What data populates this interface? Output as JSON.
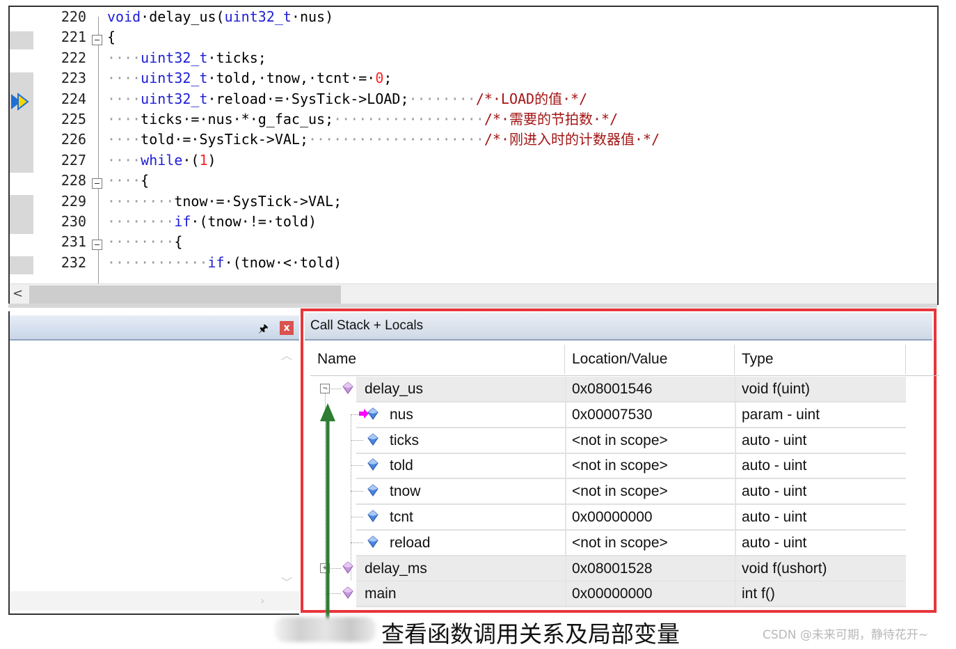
{
  "editor": {
    "lines": [
      {
        "num": "220",
        "code": [
          {
            "t": "void",
            "c": "kw"
          },
          {
            "t": "·delay_us(",
            "c": ""
          },
          {
            "t": "uint32_t",
            "c": "kw"
          },
          {
            "t": "·nus)",
            "c": ""
          }
        ]
      },
      {
        "num": "221",
        "code": [
          {
            "t": "{",
            "c": ""
          }
        ]
      },
      {
        "num": "222",
        "code": [
          {
            "t": "····",
            "c": "dot"
          },
          {
            "t": "uint32_t",
            "c": "kw"
          },
          {
            "t": "·ticks;",
            "c": ""
          }
        ]
      },
      {
        "num": "223",
        "code": [
          {
            "t": "····",
            "c": "dot"
          },
          {
            "t": "uint32_t",
            "c": "kw"
          },
          {
            "t": "·told,·tnow,·tcnt·=·",
            "c": ""
          },
          {
            "t": "0",
            "c": "num"
          },
          {
            "t": ";",
            "c": ""
          }
        ]
      },
      {
        "num": "224",
        "code": [
          {
            "t": "····",
            "c": "dot"
          },
          {
            "t": "uint32_t",
            "c": "kw"
          },
          {
            "t": "·reload·=·SysTick->LOAD;",
            "c": ""
          },
          {
            "t": "········",
            "c": "dot"
          },
          {
            "t": "/*·LOAD的值·*/",
            "c": "cmt"
          }
        ]
      },
      {
        "num": "225",
        "code": [
          {
            "t": "····",
            "c": "dot"
          },
          {
            "t": "ticks·=·nus·*·g_fac_us;",
            "c": ""
          },
          {
            "t": "··················",
            "c": "dot"
          },
          {
            "t": "/*·需要的节拍数·*/",
            "c": "cmt"
          }
        ]
      },
      {
        "num": "226",
        "code": [
          {
            "t": "····",
            "c": "dot"
          },
          {
            "t": "told·=·SysTick->VAL;",
            "c": ""
          },
          {
            "t": "·····················",
            "c": "dot"
          },
          {
            "t": "/*·刚进入时的计数器值·*/",
            "c": "cmt"
          }
        ]
      },
      {
        "num": "227",
        "code": [
          {
            "t": "····",
            "c": "dot"
          },
          {
            "t": "while",
            "c": "kw"
          },
          {
            "t": "·(",
            "c": ""
          },
          {
            "t": "1",
            "c": "num"
          },
          {
            "t": ")",
            "c": ""
          }
        ]
      },
      {
        "num": "228",
        "code": [
          {
            "t": "····",
            "c": "dot"
          },
          {
            "t": "{",
            "c": ""
          }
        ]
      },
      {
        "num": "229",
        "code": [
          {
            "t": "········",
            "c": "dot"
          },
          {
            "t": "tnow·=·SysTick->VAL;",
            "c": ""
          }
        ]
      },
      {
        "num": "230",
        "code": [
          {
            "t": "········",
            "c": "dot"
          },
          {
            "t": "if",
            "c": "kw"
          },
          {
            "t": "·(tnow·!=·told)",
            "c": ""
          }
        ]
      },
      {
        "num": "231",
        "code": [
          {
            "t": "········",
            "c": "dot"
          },
          {
            "t": "{",
            "c": ""
          }
        ]
      },
      {
        "num": "232",
        "code": [
          {
            "t": "············",
            "c": "dot"
          },
          {
            "t": "if",
            "c": "kw"
          },
          {
            "t": "·(tnow·<·told)",
            "c": ""
          }
        ]
      }
    ],
    "scroll_left_glyph": "<"
  },
  "left_panel": {
    "pin_glyph": "🖈",
    "close_glyph": "x"
  },
  "callstack": {
    "title": "Call Stack + Locals",
    "headers": {
      "name": "Name",
      "location": "Location/Value",
      "type": "Type"
    },
    "rows": [
      {
        "kind": "frame",
        "expand": "−",
        "name": "delay_us",
        "location": "0x08001546",
        "type": "void f(uint)"
      },
      {
        "kind": "param",
        "name": "nus",
        "location": "0x00007530",
        "type": "param - uint"
      },
      {
        "kind": "local",
        "name": "ticks",
        "location": "<not in scope>",
        "type": "auto - uint"
      },
      {
        "kind": "local",
        "name": "told",
        "location": "<not in scope>",
        "type": "auto - uint"
      },
      {
        "kind": "local",
        "name": "tnow",
        "location": "<not in scope>",
        "type": "auto - uint"
      },
      {
        "kind": "local",
        "name": "tcnt",
        "location": "0x00000000",
        "type": "auto - uint"
      },
      {
        "kind": "local",
        "name": "reload",
        "location": "<not in scope>",
        "type": "auto - uint"
      },
      {
        "kind": "frame",
        "expand": "+",
        "name": "delay_ms",
        "location": "0x08001528",
        "type": "void f(ushort)"
      },
      {
        "kind": "frame",
        "expand": "",
        "name": "main",
        "location": "0x00000000",
        "type": "int f()"
      }
    ]
  },
  "caption": "查看函数调用关系及局部变量",
  "watermark": "CSDN @未来可期，静待花开~",
  "colors": {
    "highlight_border": "#e8353b",
    "arrow": "#2e7d32",
    "keyword": "#1d1dd6",
    "comment": "#a31515"
  }
}
